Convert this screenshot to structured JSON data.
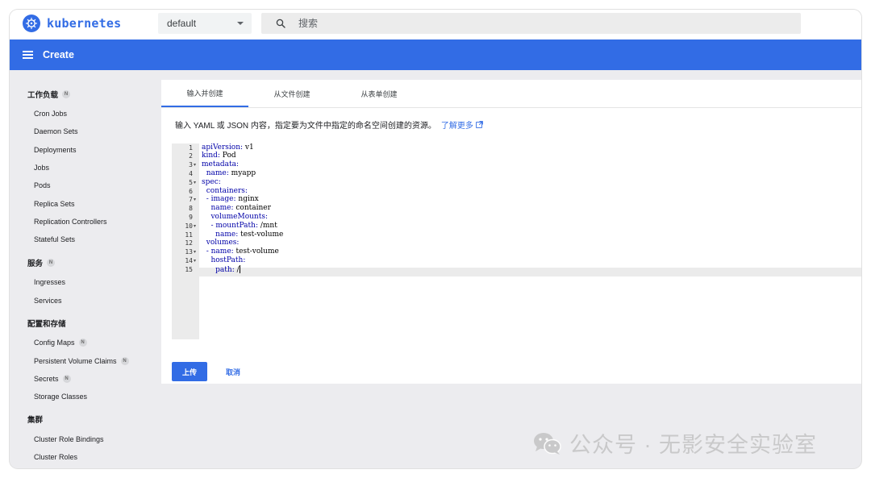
{
  "app": {
    "name": "kubernetes"
  },
  "namespace": {
    "selected": "default"
  },
  "search": {
    "placeholder": "搜索"
  },
  "header": {
    "title": "Create"
  },
  "sidebar": {
    "sections": [
      {
        "label": "工作负载",
        "badge": "N",
        "items": [
          "Cron Jobs",
          "Daemon Sets",
          "Deployments",
          "Jobs",
          "Pods",
          "Replica Sets",
          "Replication Controllers",
          "Stateful Sets"
        ]
      },
      {
        "label": "服务",
        "badge": "N",
        "items": [
          "Ingresses",
          "Services"
        ]
      },
      {
        "label": "配置和存储",
        "items": [
          "Config Maps",
          "Persistent Volume Claims",
          "Secrets",
          "Storage Classes"
        ],
        "item_badges": [
          "N",
          "N",
          "N",
          ""
        ]
      },
      {
        "label": "集群",
        "items": [
          "Cluster Role Bindings",
          "Cluster Roles"
        ]
      }
    ]
  },
  "tabs": [
    "输入并创建",
    "从文件创建",
    "从表单创建"
  ],
  "description": "输入 YAML 或 JSON 内容，指定要为文件中指定的命名空间创建的资源。",
  "learn_more": "了解更多",
  "editor": {
    "lines": [
      {
        "n": "1",
        "fold": false,
        "indent": "",
        "key": "apiVersion:",
        "val": " v1"
      },
      {
        "n": "2",
        "fold": false,
        "indent": "",
        "key": "kind:",
        "val": " Pod"
      },
      {
        "n": "3",
        "fold": true,
        "indent": "",
        "key": "metadata:",
        "val": ""
      },
      {
        "n": "4",
        "fold": false,
        "indent": "  ",
        "key": "name:",
        "val": " myapp"
      },
      {
        "n": "5",
        "fold": true,
        "indent": "",
        "key": "spec:",
        "val": ""
      },
      {
        "n": "6",
        "fold": false,
        "indent": "  ",
        "key": "containers:",
        "val": ""
      },
      {
        "n": "7",
        "fold": true,
        "indent": "  - ",
        "key": "image:",
        "val": " nginx"
      },
      {
        "n": "8",
        "fold": false,
        "indent": "    ",
        "key": "name:",
        "val": " container"
      },
      {
        "n": "9",
        "fold": false,
        "indent": "    ",
        "key": "volumeMounts:",
        "val": ""
      },
      {
        "n": "10",
        "fold": true,
        "indent": "    - ",
        "key": "mountPath:",
        "val": " /mnt"
      },
      {
        "n": "11",
        "fold": false,
        "indent": "      ",
        "key": "name:",
        "val": " test-volume"
      },
      {
        "n": "12",
        "fold": false,
        "indent": "  ",
        "key": "volumes:",
        "val": ""
      },
      {
        "n": "13",
        "fold": true,
        "indent": "  - ",
        "key": "name:",
        "val": " test-volume"
      },
      {
        "n": "14",
        "fold": true,
        "indent": "    ",
        "key": "hostPath:",
        "val": ""
      },
      {
        "n": "15",
        "fold": false,
        "indent": "      ",
        "key": "path:",
        "val": " /"
      }
    ]
  },
  "buttons": {
    "upload": "上传",
    "cancel": "取消"
  },
  "watermark": {
    "text": "公众号 · 无影安全实验室"
  },
  "colors": {
    "primary": "#326ce5",
    "sidebar_bg": "#ececef",
    "gutter": "#ebebeb"
  }
}
